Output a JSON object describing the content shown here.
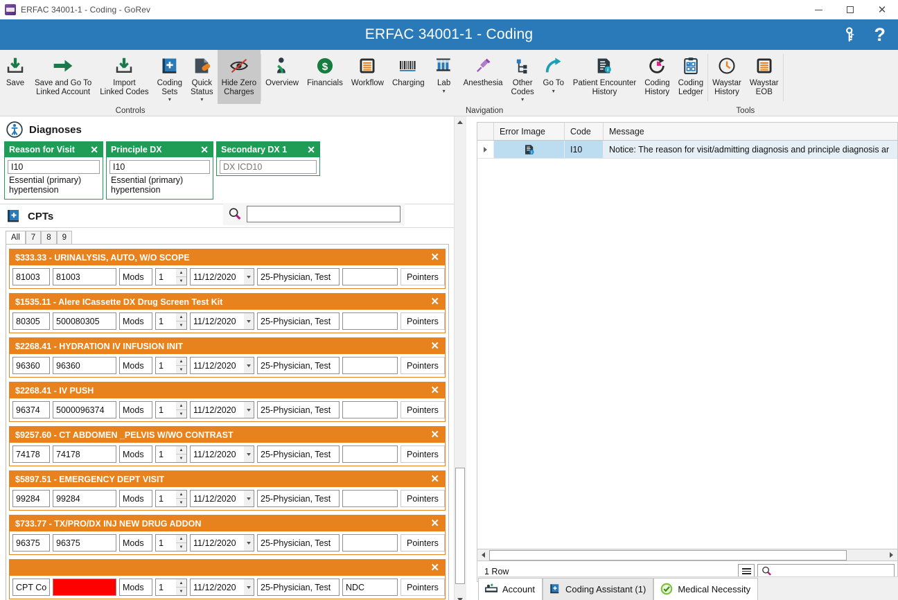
{
  "window": {
    "title": "ERFAC 34001-1 - Coding - GoRev",
    "app_icon": "gorev-app-icon",
    "minimize": "minimize-icon",
    "maximize": "maximize-icon",
    "close": "close-icon"
  },
  "header": {
    "title": "ERFAC 34001-1 - Coding",
    "key_icon": "key-icon",
    "help_icon": "help-question-icon",
    "bg_color": "#2a7ab9"
  },
  "ribbon": {
    "groups": [
      {
        "label": "Controls",
        "items": [
          {
            "label": "Save",
            "icon": "save-download-icon",
            "active": false,
            "caret": false
          },
          {
            "label": "Save and Go To\nLinked Account",
            "icon": "arrow-right-icon",
            "active": false,
            "caret": false
          },
          {
            "label": "Import\nLinked Codes",
            "icon": "import-download-icon",
            "active": false,
            "caret": false
          },
          {
            "label": "Coding\nSets",
            "icon": "book-plus-icon",
            "active": false,
            "caret": true
          },
          {
            "label": "Quick\nStatus",
            "icon": "page-pill-icon",
            "active": false,
            "caret": true
          },
          {
            "label": "Hide Zero\nCharges",
            "icon": "eye-slash-icon",
            "active": true,
            "caret": false
          }
        ]
      },
      {
        "label": "Navigation",
        "items": [
          {
            "label": "Overview",
            "icon": "patient-person-icon",
            "active": false,
            "caret": false
          },
          {
            "label": "Financials",
            "icon": "dollar-circle-icon",
            "active": false,
            "caret": false
          },
          {
            "label": "Workflow",
            "icon": "list-lines-icon",
            "active": false,
            "caret": false
          },
          {
            "label": "Charging",
            "icon": "barcode-icon",
            "active": false,
            "caret": false
          },
          {
            "label": "Lab",
            "icon": "test-tubes-icon",
            "active": false,
            "caret": true
          },
          {
            "label": "Anesthesia",
            "icon": "syringe-icon",
            "active": false,
            "caret": false
          },
          {
            "label": "Other\nCodes",
            "icon": "sitemap-icon",
            "active": false,
            "caret": true
          },
          {
            "label": "Go To",
            "icon": "curved-arrow-icon",
            "active": false,
            "caret": true
          },
          {
            "label": "Patient Encounter\nHistory",
            "icon": "document-info-icon",
            "active": false,
            "caret": false
          },
          {
            "label": "Coding\nHistory",
            "icon": "refresh-pie-icon",
            "active": false,
            "caret": false
          },
          {
            "label": "Coding\nLedger",
            "icon": "clipboard-check-icon",
            "active": false,
            "caret": false
          }
        ]
      },
      {
        "label": "Tools",
        "items": [
          {
            "label": "Waystar\nHistory",
            "icon": "clock-icon",
            "active": false,
            "caret": false
          },
          {
            "label": "Waystar\nEOB",
            "icon": "list-lines-icon",
            "active": false,
            "caret": false
          }
        ]
      }
    ]
  },
  "diagnoses": {
    "section_title": "Diagnoses",
    "section_icon": "patient-diagnoses-icon",
    "accent_color": "#1f9d57",
    "cards": [
      {
        "title": "Reason for Visit",
        "code": "I10",
        "description": "Essential (primary) hypertension",
        "close_icon": "close-icon",
        "placeholder": ""
      },
      {
        "title": "Principle DX",
        "code": "I10",
        "description": "Essential (primary) hypertension",
        "close_icon": "close-icon",
        "placeholder": ""
      },
      {
        "title": "Secondary DX 1",
        "code": "",
        "description": "",
        "close_icon": "close-icon",
        "placeholder": "DX ICD10"
      }
    ]
  },
  "cpts": {
    "section_title": "CPTs",
    "section_icon": "book-plus-icon",
    "search_icon": "search-icon",
    "search_value": "",
    "search_placeholder": "",
    "accent_color": "#e8821e",
    "tabs": [
      {
        "label": "All",
        "selected": true
      },
      {
        "label": "7",
        "selected": false
      },
      {
        "label": "8",
        "selected": false
      },
      {
        "label": "9",
        "selected": false
      }
    ],
    "field_labels": {
      "mods": "Mods",
      "pointers": "Pointers"
    },
    "items": [
      {
        "title": "$333.33 - URINALYSIS, AUTO, W/O SCOPE",
        "code": "81003",
        "desc": "81003",
        "mods": "Mods",
        "units": "1",
        "date": "11/12/2020",
        "provider": "25-Physician, Test",
        "ndc": "",
        "pointers": "Pointers",
        "desc_red": false
      },
      {
        "title": "$1535.11 - Alere ICassette DX Drug Screen Test Kit",
        "code": "80305",
        "desc": "500080305",
        "mods": "Mods",
        "units": "1",
        "date": "11/12/2020",
        "provider": "25-Physician, Test",
        "ndc": "",
        "pointers": "Pointers",
        "desc_red": false
      },
      {
        "title": "$2268.41 - HYDRATION IV INFUSION INIT",
        "code": "96360",
        "desc": "96360",
        "mods": "Mods",
        "units": "1",
        "date": "11/12/2020",
        "provider": "25-Physician, Test",
        "ndc": "",
        "pointers": "Pointers",
        "desc_red": false
      },
      {
        "title": "$2268.41 - IV PUSH",
        "code": "96374",
        "desc": "5000096374",
        "mods": "Mods",
        "units": "1",
        "date": "11/12/2020",
        "provider": "25-Physician, Test",
        "ndc": "",
        "pointers": "Pointers",
        "desc_red": false
      },
      {
        "title": "$9257.60 - CT ABDOMEN _PELVIS W/WO CONTRAST",
        "code": "74178",
        "desc": "74178",
        "mods": "Mods",
        "units": "1",
        "date": "11/12/2020",
        "provider": "25-Physician, Test",
        "ndc": "",
        "pointers": "Pointers",
        "desc_red": false
      },
      {
        "title": "$5897.51 - EMERGENCY DEPT VISIT",
        "code": "99284",
        "desc": "99284",
        "mods": "Mods",
        "units": "1",
        "date": "11/12/2020",
        "provider": "25-Physician, Test",
        "ndc": "",
        "pointers": "Pointers",
        "desc_red": false
      },
      {
        "title": "$733.77 - TX/PRO/DX INJ NEW DRUG ADDON",
        "code": "96375",
        "desc": "96375",
        "mods": "Mods",
        "units": "1",
        "date": "11/12/2020",
        "provider": "25-Physician, Test",
        "ndc": "",
        "pointers": "Pointers",
        "desc_red": false
      },
      {
        "title": "",
        "code": "CPT Co",
        "desc": "",
        "mods": "Mods",
        "units": "1",
        "date": "11/12/2020",
        "provider": "25-Physician, Test",
        "ndc": "NDC",
        "pointers": "Pointers",
        "desc_red": true
      }
    ]
  },
  "errors_grid": {
    "columns": [
      "Error Image",
      "Code",
      "Message"
    ],
    "rows": [
      {
        "expander": "row-expand-arrow",
        "error_image": "document-info-icon",
        "code": "I10",
        "message": "Notice: The reason for visit/admitting diagnosis and principle diagnosis ar"
      }
    ],
    "status": "1 Row",
    "menu_icon": "hamburger-menu-icon",
    "search_icon": "search-icon",
    "search_value": "",
    "search_placeholder": ""
  },
  "bottom_tabs": [
    {
      "label": "Account",
      "icon": "bed-patient-icon",
      "selected": true
    },
    {
      "label": "Coding Assistant (1)",
      "icon": "book-plus-icon",
      "selected": false
    },
    {
      "label": "Medical Necessity",
      "icon": "check-circle-icon",
      "selected": true
    }
  ]
}
